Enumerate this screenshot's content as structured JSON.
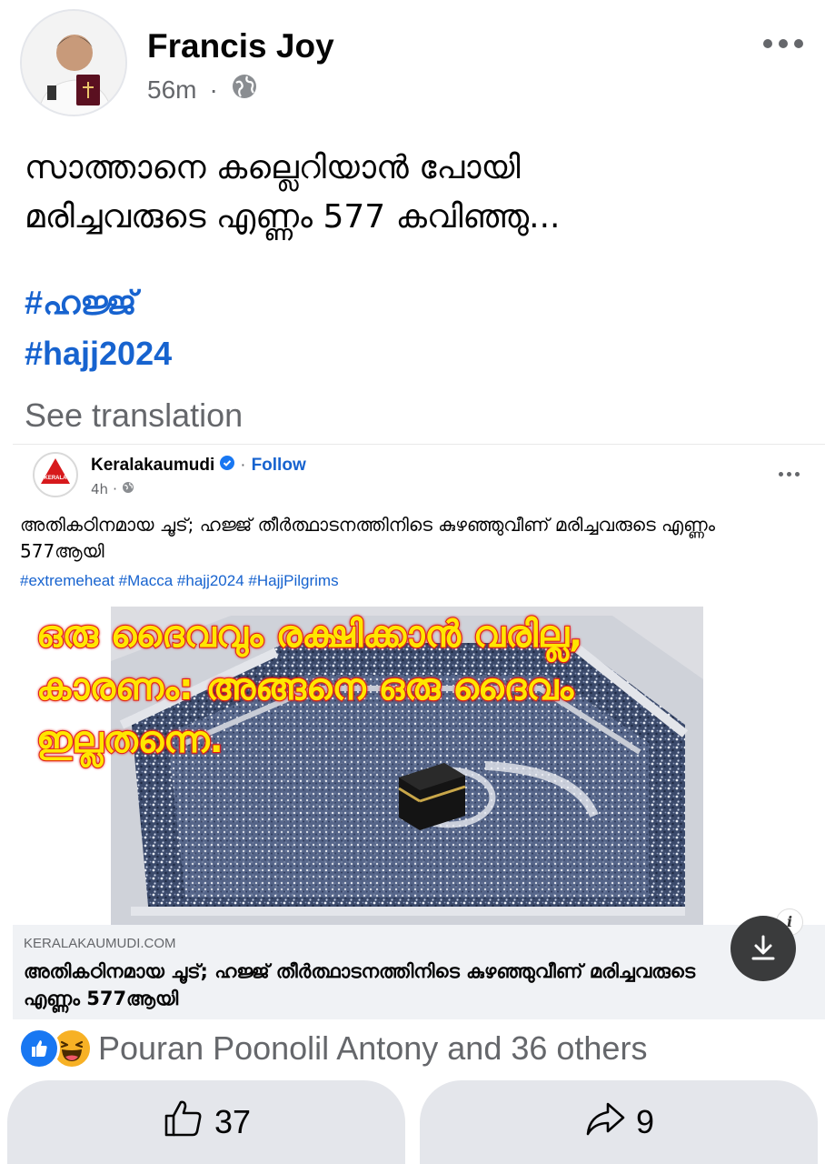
{
  "post": {
    "author": "Francis Joy",
    "time": "56m",
    "separator": "·",
    "privacy_icon": "globe-icon",
    "more_icon": "more-horizontal-icon",
    "text_line1": "സാത്താനെ കല്ലെറിയാൻ പോയി",
    "text_line2": "മരിച്ചവരുടെ എണ്ണം 577 കവിഞ്ഞു...",
    "hashtag1": "#ഹജ്ജ്",
    "hashtag2": "#hajj2024",
    "see_translation": "See translation"
  },
  "shared": {
    "page_name": "Keralakaumudi",
    "verified_icon": "verified-badge-icon",
    "follow_sep": "·",
    "follow_label": "Follow",
    "time": "4h",
    "meta_sep": "·",
    "text": "അതികഠിനമായ ചൂട്; ഹജ്ജ് തീർത്ഥാടനത്തിനിടെ കുഴഞ്ഞുവീണ് മരിച്ചവരുടെ എണ്ണം 577ആയി",
    "tags": "#extremeheat #Macca #hajj2024 #HajjPilgrims",
    "overlay_line1": "ഒരു ദൈവവും രക്ഷിക്കാൻ വരില്ല,",
    "overlay_line2": "കാരണം: അങ്ങനെ ഒരു ദൈവം",
    "overlay_line3": "ഇല്ലതന്നെ.",
    "link_domain": "KERALAKAUMUDI.COM",
    "link_title": "അതികഠിനമായ ചൂട്; ഹജ്ജ് തീർത്ഥാടനത്തിനിടെ കുഴഞ്ഞുവീണ് മരിച്ചവരുടെ എണ്ണം 577ആയി",
    "info_label": "i"
  },
  "reactions": {
    "icons": [
      "like-reaction-icon",
      "haha-reaction-icon"
    ],
    "text": "Pouran Poonolil Antony and 36 others"
  },
  "actions": {
    "like_count": "37",
    "share_count": "9"
  },
  "colors": {
    "link_blue": "#1763cf",
    "secondary_gray": "#65676b",
    "like_blue": "#1877f2",
    "overlay_yellow": "#ffe600",
    "overlay_red": "#e01b1b"
  }
}
